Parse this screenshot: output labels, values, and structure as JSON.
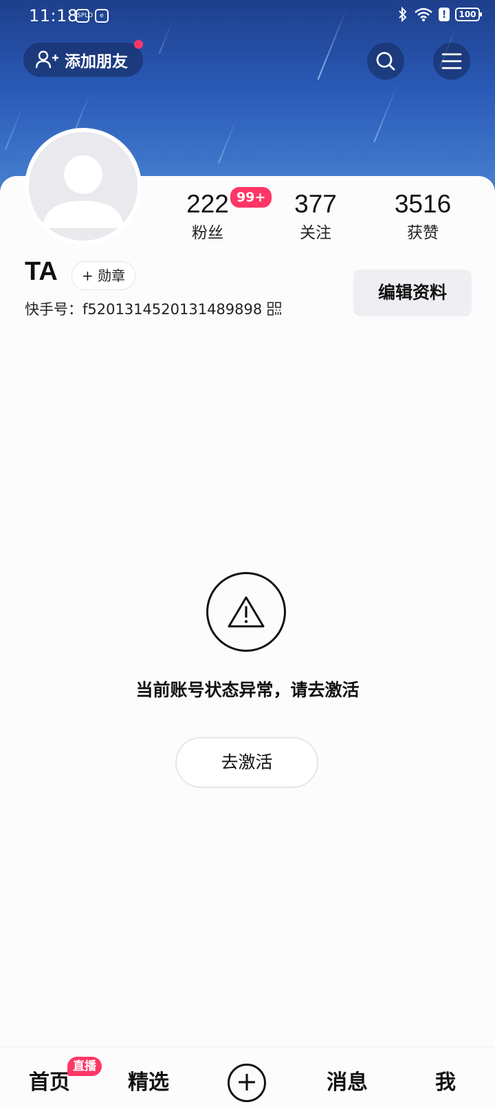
{
  "status_bar": {
    "time": "11:18",
    "battery": "100",
    "left_icons": [
      "SPLD",
      "e"
    ],
    "right_icons": [
      "bluetooth-icon",
      "wifi-icon",
      "alert-icon",
      "battery-icon"
    ]
  },
  "header": {
    "add_friend_label": "添加朋友",
    "icons": [
      "add-friend-icon",
      "search-icon",
      "menu-icon"
    ]
  },
  "profile": {
    "stats": [
      {
        "value": "222",
        "label": "粉丝"
      },
      {
        "value": "377",
        "label": "关注"
      },
      {
        "value": "3516",
        "label": "获赞"
      }
    ],
    "fans_badge": "99+",
    "username": "TA",
    "medal_label": "+ 勋章",
    "kuaishou_id": "快手号：f5201314520131489898",
    "edit_label": "编辑资料"
  },
  "notice": {
    "icon": "warning-icon",
    "text": "当前账号状态异常，请去激活",
    "button": "去激活"
  },
  "tabbar": {
    "items": [
      "首页",
      "精选",
      "消息",
      "我"
    ],
    "live_badge": "直播",
    "plus": "+"
  },
  "colors": {
    "accent": "#fe3666",
    "header_top": "#1e3f8c",
    "header_bottom": "#4b86d4"
  }
}
